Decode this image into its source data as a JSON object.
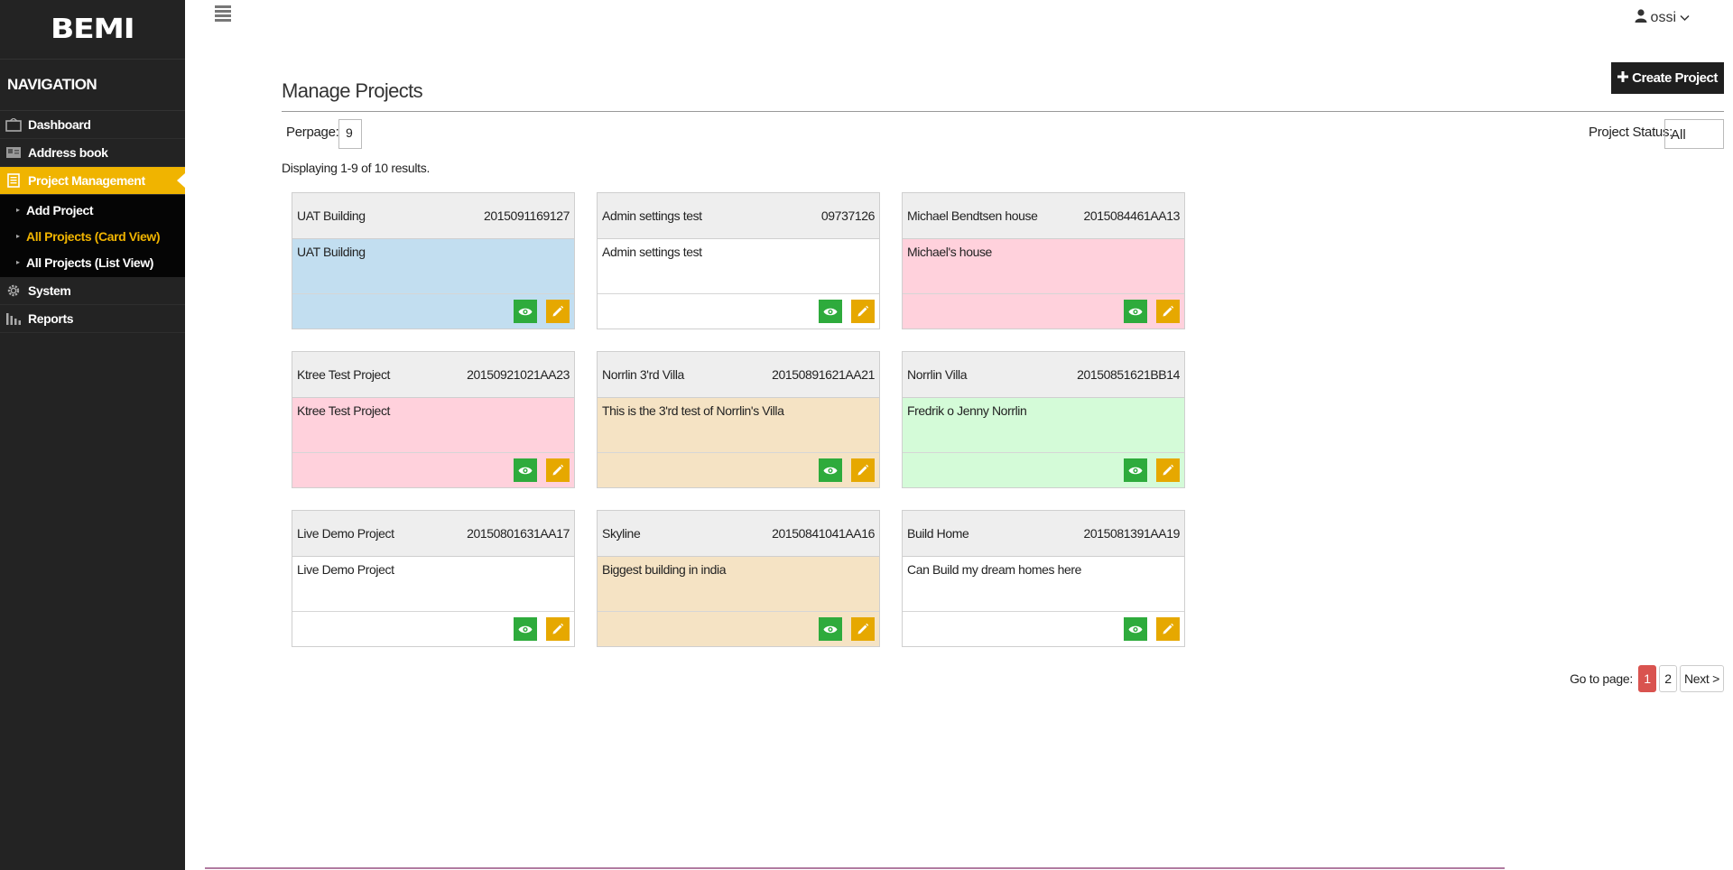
{
  "colors": {
    "sidebar_bg": "#232323",
    "accent": "#f0b400",
    "view_button": "#2eab3c",
    "edit_button": "#e6a800",
    "pager_active": "#d9534f"
  },
  "sidebar": {
    "logo": "BEMI",
    "nav_title": "NAVIGATION",
    "items": [
      {
        "label": "Dashboard",
        "icon": "dashboard-icon"
      },
      {
        "label": "Address book",
        "icon": "address-book-icon"
      },
      {
        "label": "Project Management",
        "icon": "document-icon",
        "active": true
      },
      {
        "label": "System",
        "icon": "gear-icon"
      },
      {
        "label": "Reports",
        "icon": "bar-chart-icon"
      }
    ],
    "sub_items": [
      {
        "label": "Add Project"
      },
      {
        "label": "All Projects (Card View)",
        "current": true
      },
      {
        "label": "All Projects (List View)"
      }
    ]
  },
  "header": {
    "user_name": "ossi"
  },
  "main": {
    "title": "Manage Projects",
    "create_button": "Create Project",
    "perpage_label": "Perpage:",
    "perpage_value": "9",
    "status_label": "Project Status:",
    "status_value": "All",
    "results": "Displaying 1-9 of 10 results."
  },
  "cards": [
    {
      "name": "UAT Building",
      "code": "2015091169127",
      "description": "UAT Building",
      "color": "#c2def0"
    },
    {
      "name": "Admin settings test",
      "code": "09737126",
      "description": "Admin settings test",
      "color": "#ffffff"
    },
    {
      "name": "Michael Bendtsen house",
      "code": "2015084461AA13",
      "description": "Michael's house",
      "color": "#ffd1dc"
    },
    {
      "name": "Ktree Test Project",
      "code": "20150921021AA23",
      "description": "Ktree Test Project",
      "color": "#ffd1dc"
    },
    {
      "name": "Norrlin 3'rd Villa",
      "code": "20150891621AA21",
      "description": "This is the 3'rd test of Norrlin's Villa",
      "color": "#f5e3c4"
    },
    {
      "name": "Norrlin Villa",
      "code": "20150851621BB14",
      "description": "Fredrik o Jenny Norrlin",
      "color": "#d4fbd8"
    },
    {
      "name": "Live Demo Project",
      "code": "20150801631AA17",
      "description": "Live Demo Project",
      "color": "#ffffff"
    },
    {
      "name": "Skyline",
      "code": "20150841041AA16",
      "description": "Biggest building in india",
      "color": "#f5e3c4"
    },
    {
      "name": "Build Home",
      "code": "2015081391AA19",
      "description": "Can Build my dream homes here",
      "color": "#ffffff"
    }
  ],
  "pagination": {
    "label": "Go to page:",
    "pages": [
      "1",
      "2"
    ],
    "current": "1",
    "next": "Next >"
  }
}
